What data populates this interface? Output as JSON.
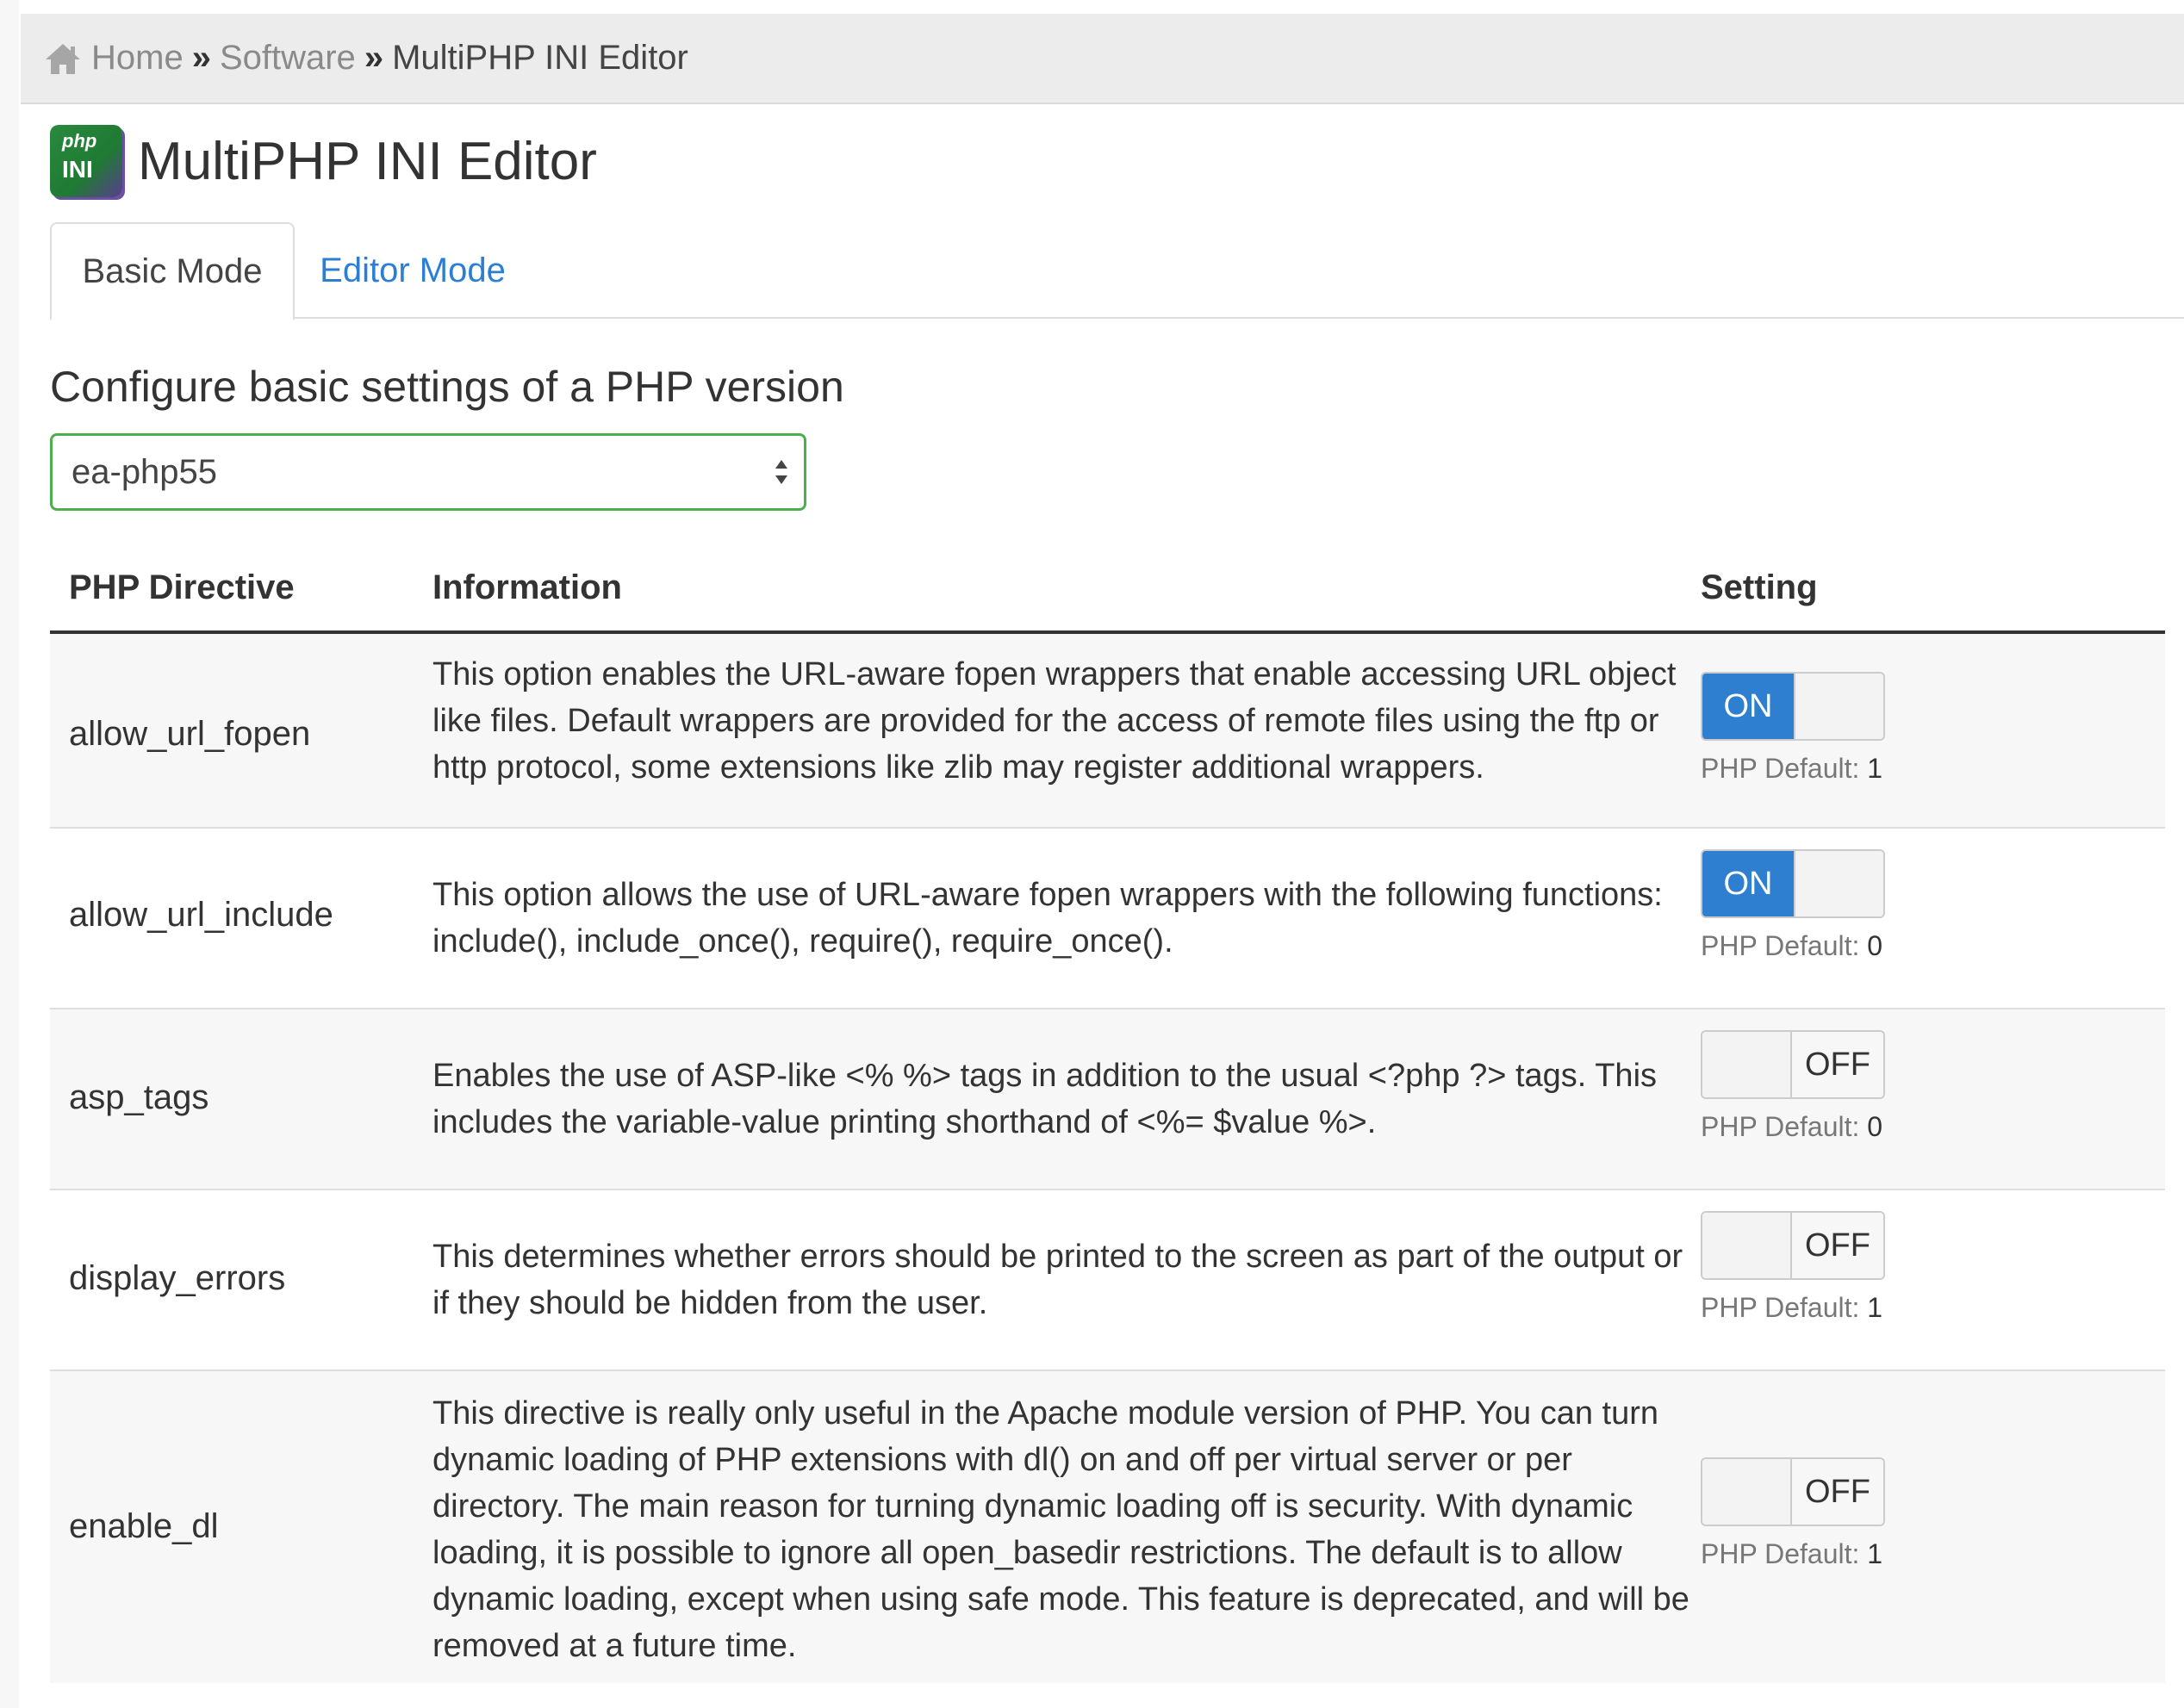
{
  "breadcrumb": {
    "home": "Home",
    "sep": "»",
    "software": "Software",
    "current": "MultiPHP INI Editor"
  },
  "app": {
    "icon_php": "php",
    "icon_ini": "INI",
    "title": "MultiPHP INI Editor"
  },
  "tabs": [
    {
      "label": "Basic Mode",
      "active": true
    },
    {
      "label": "Editor Mode",
      "active": false
    }
  ],
  "section_heading": "Configure basic settings of a PHP version",
  "version_select": {
    "value": "ea-php55"
  },
  "table": {
    "headers": {
      "directive": "PHP Directive",
      "information": "Information",
      "setting": "Setting"
    },
    "default_label": "PHP Default:",
    "on_label": "ON",
    "off_label": "OFF",
    "rows": [
      {
        "directive": "allow_url_fopen",
        "information": "This option enables the URL-aware fopen wrappers that enable accessing URL object like files. Default wrappers are provided for the access of remote files using the ftp or http protocol, some extensions like zlib may register additional wrappers.",
        "setting": "ON",
        "php_default": "1"
      },
      {
        "directive": "allow_url_include",
        "information": "This option allows the use of URL-aware fopen wrappers with the following functions: include(), include_once(), require(), require_once().",
        "setting": "ON",
        "php_default": "0"
      },
      {
        "directive": "asp_tags",
        "information": "Enables the use of ASP-like <% %> tags in addition to the usual <?php ?> tags. This includes the variable-value printing shorthand of <%= $value %>.",
        "setting": "OFF",
        "php_default": "0"
      },
      {
        "directive": "display_errors",
        "information": "This determines whether errors should be printed to the screen as part of the output or if they should be hidden from the user.",
        "setting": "OFF",
        "php_default": "1"
      },
      {
        "directive": "enable_dl",
        "information": "This directive is really only useful in the Apache module version of PHP. You can turn dynamic loading of PHP extensions with dl() on and off per virtual server or per directory. The main reason for turning dynamic loading off is security. With dynamic loading, it is possible to ignore all open_basedir restrictions. The default is to allow dynamic loading, except when using safe mode. This feature is deprecated, and will be removed at a future time.",
        "setting": "OFF",
        "php_default": "1"
      }
    ]
  },
  "colors": {
    "accent": "#2f7fd1",
    "select_border": "#4cae4c",
    "link": "#2a7fd4"
  }
}
